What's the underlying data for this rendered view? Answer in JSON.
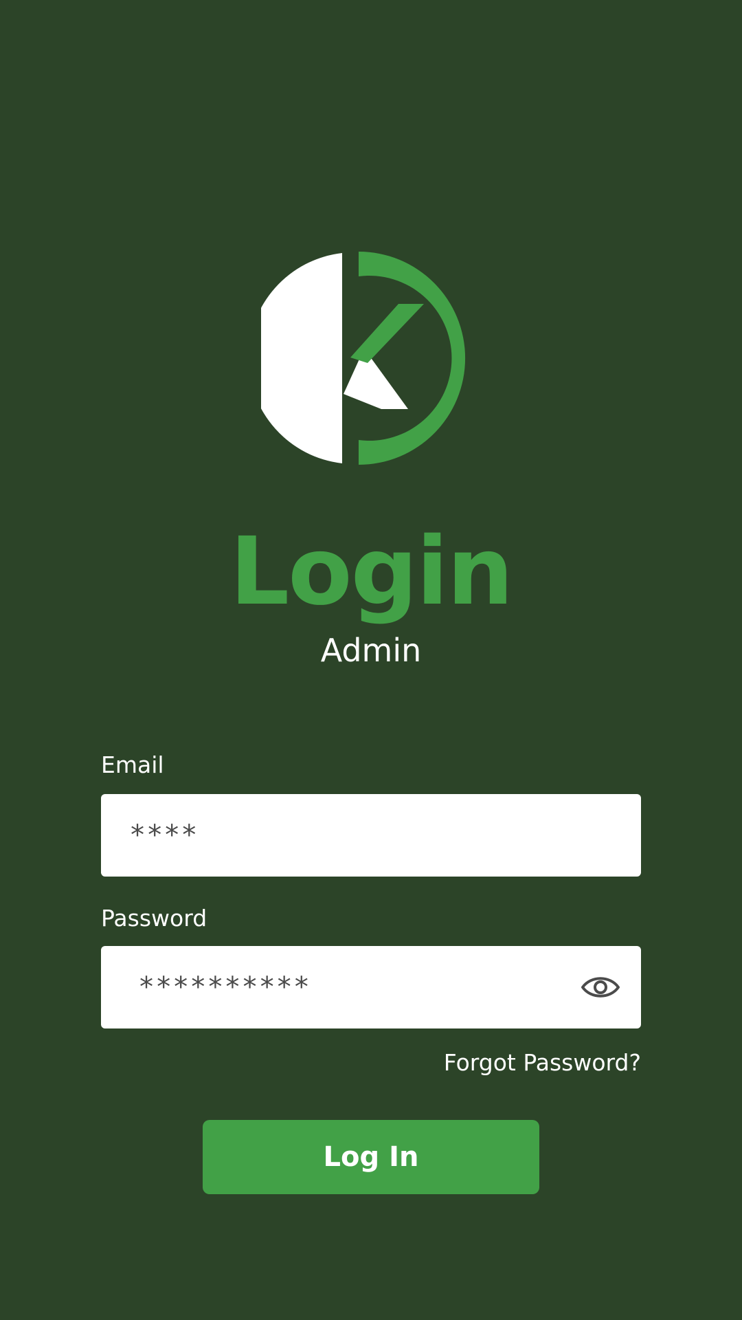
{
  "colors": {
    "background": "#2c4428",
    "accent": "#42a147",
    "text": "#ffffff",
    "input_background": "#ffffff",
    "input_text": "#4b4b4b"
  },
  "logo": {
    "icon": "k-circle-logo-icon",
    "letter": "K"
  },
  "header": {
    "title": "Login",
    "subtitle": "Admin"
  },
  "form": {
    "email": {
      "label": "Email",
      "value": "****"
    },
    "password": {
      "label": "Password",
      "value": "**********",
      "toggle_icon": "eye-icon"
    },
    "forgot_password": "Forgot Password?",
    "submit_label": "Log In"
  }
}
